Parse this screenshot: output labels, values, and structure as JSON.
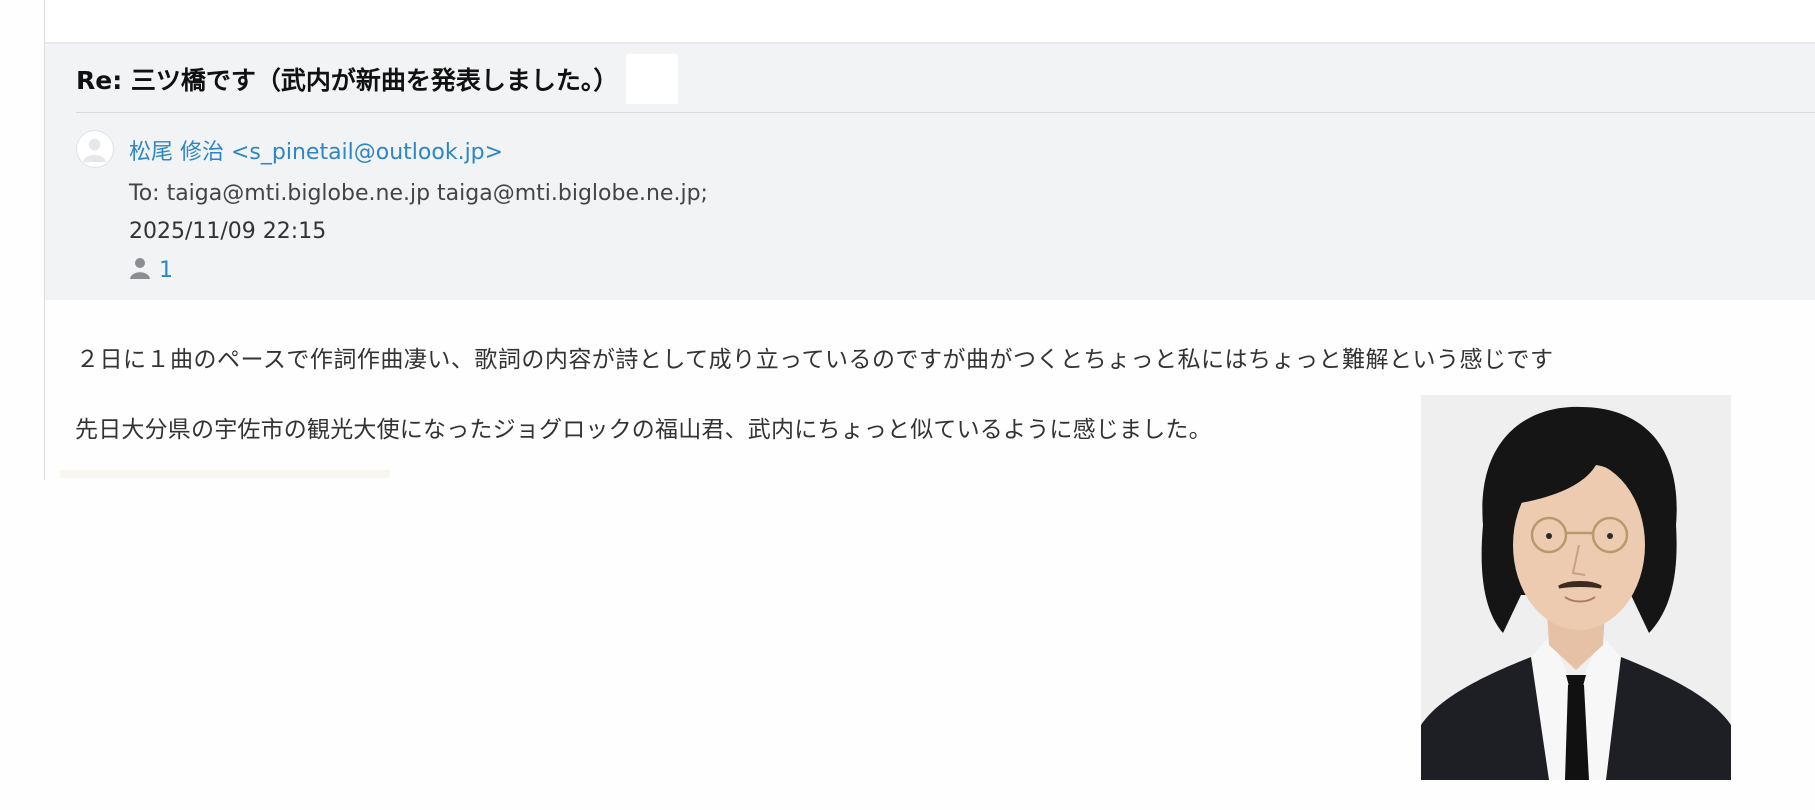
{
  "email": {
    "subject": "Re: 三ツ橋です（武内が新曲を発表しました。）",
    "sender": "松尾 修治 <s_pinetail@outlook.jp>",
    "to": "To: taiga@mti.biglobe.ne.jp taiga@mti.biglobe.ne.jp;",
    "date": "2025/11/09 22:15",
    "recipient_count": "1",
    "icons": {
      "avatar": "avatar-placeholder",
      "recipients": "person-icon"
    },
    "body": [
      "２日に１曲のペースで作詞作曲凄い、歌詞の内容が詩として成り立っているのですが曲がつくとちょっと私にはちょっと難解という感じです",
      "先日大分県の宇佐市の観光大使になったジョグロックの福山君、武内にちょっと似ているように感じました。"
    ],
    "attachment": "portrait-photo"
  },
  "colors": {
    "link": "#2f86c4",
    "header_bg": "#f2f3f5",
    "page_bg": "#fefefe"
  }
}
